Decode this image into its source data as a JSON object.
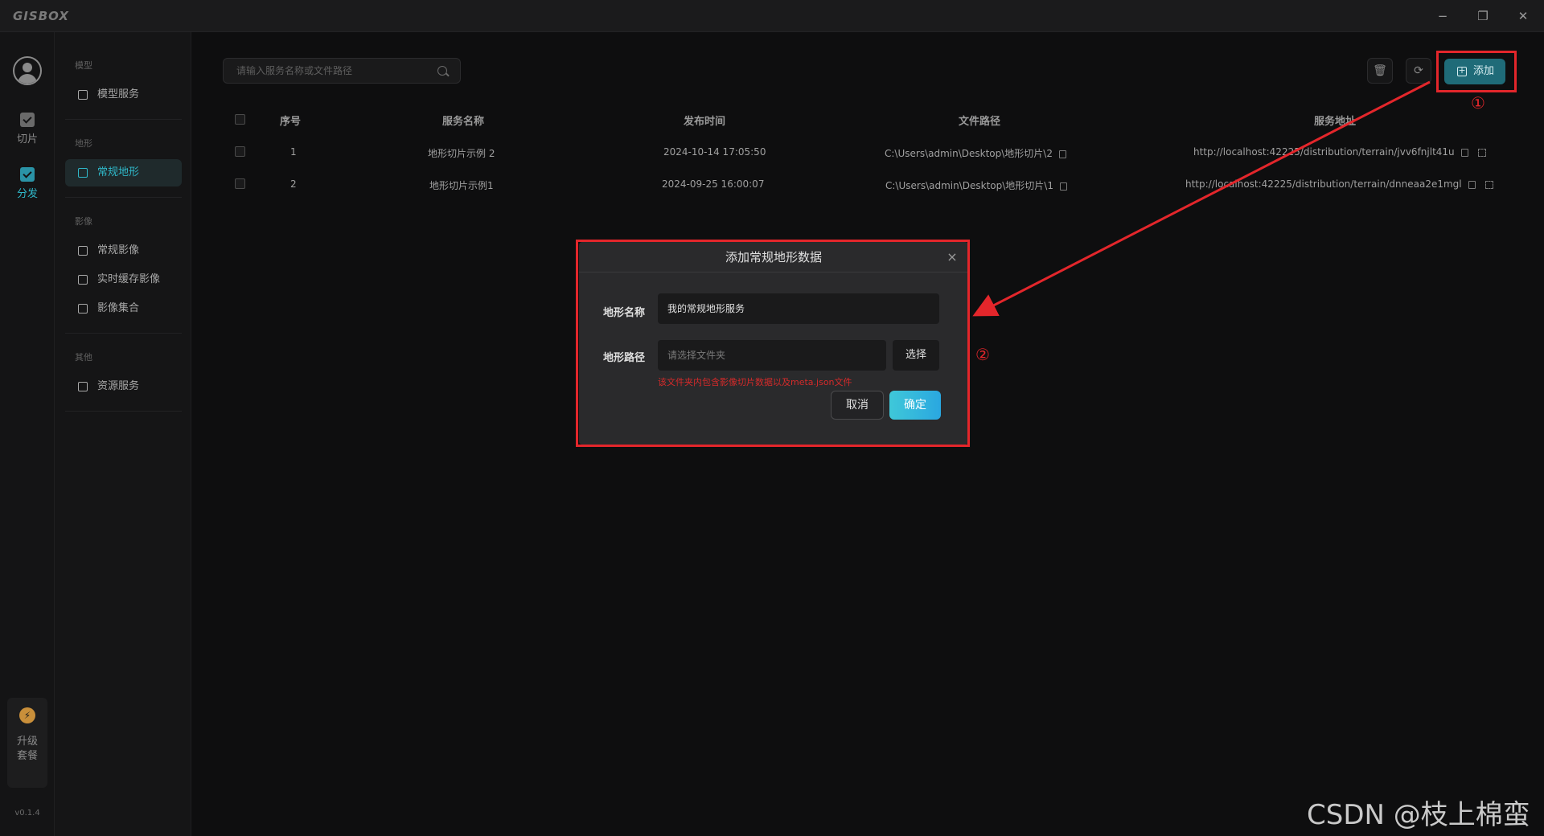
{
  "app": {
    "logo": "GISBOX",
    "version": "v0.1.4"
  },
  "window_controls": {
    "minimize": "−",
    "restore": "❐",
    "close": "✕"
  },
  "rail": {
    "items": [
      {
        "label": "切片",
        "icon": "tile-icon"
      },
      {
        "label": "分发",
        "icon": "distribute-icon"
      }
    ],
    "upgrade": {
      "line1": "升级",
      "line2": "套餐"
    }
  },
  "nav": {
    "groups": [
      {
        "title": "模型",
        "items": [
          {
            "label": "模型服务"
          }
        ]
      },
      {
        "title": "地形",
        "items": [
          {
            "label": "常规地形"
          }
        ]
      },
      {
        "title": "影像",
        "items": [
          {
            "label": "常规影像"
          },
          {
            "label": "实时缓存影像"
          },
          {
            "label": "影像集合"
          }
        ]
      },
      {
        "title": "其他",
        "items": [
          {
            "label": "资源服务"
          }
        ]
      }
    ]
  },
  "toolbar": {
    "search_placeholder": "请输入服务名称或文件路径",
    "add_label": "添加"
  },
  "table": {
    "columns": [
      "序号",
      "服务名称",
      "发布时间",
      "文件路径",
      "服务地址"
    ],
    "rows": [
      {
        "index": "1",
        "name": "地形切片示例 2",
        "time": "2024-10-14 17:05:50",
        "path": "C:\\Users\\admin\\Desktop\\地形切片\\2",
        "url": "http://localhost:42225/distribution/terrain/jvv6fnjlt41u"
      },
      {
        "index": "2",
        "name": "地形切片示例1",
        "time": "2024-09-25 16:00:07",
        "path": "C:\\Users\\admin\\Desktop\\地形切片\\1",
        "url": "http://localhost:42225/distribution/terrain/dnneaa2e1mgl"
      }
    ]
  },
  "dialog": {
    "title": "添加常规地形数据",
    "close": "×",
    "name_label": "地形名称",
    "name_value": "我的常规地形服务",
    "path_label": "地形路径",
    "path_placeholder": "请选择文件夹",
    "select_label": "选择",
    "hint": "该文件夹内包含影像切片数据以及meta.json文件",
    "cancel_label": "取消",
    "ok_label": "确定"
  },
  "annotations": {
    "marker1": "①",
    "marker2": "②",
    "color": "#e3262b"
  },
  "watermark": "CSDN @枝上棉蛮"
}
